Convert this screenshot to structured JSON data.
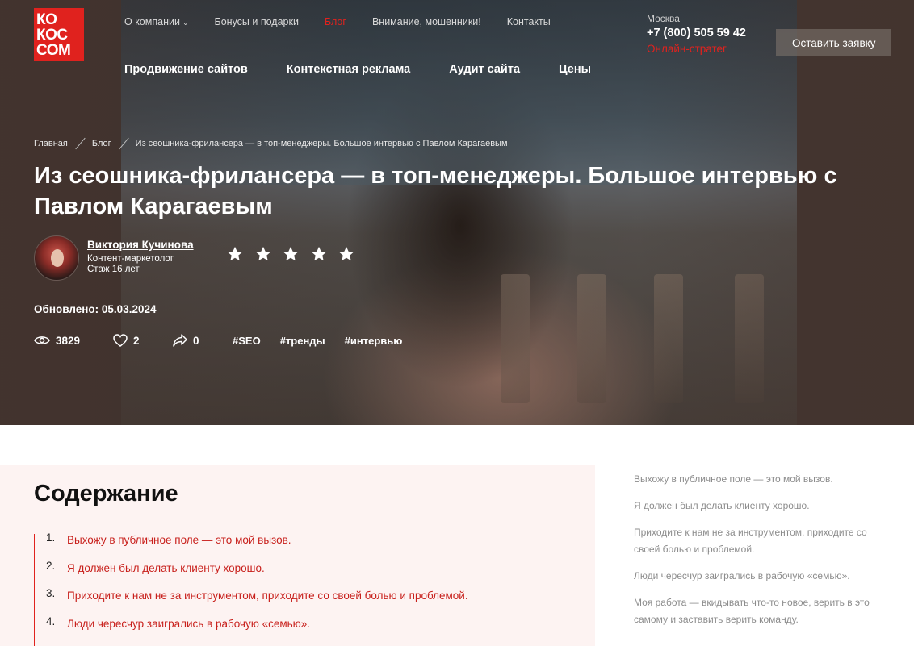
{
  "logo": {
    "lines": [
      "КО",
      "КОС",
      "СОМ"
    ]
  },
  "topnav": [
    {
      "label": "О компании",
      "dropdown": true,
      "active": false
    },
    {
      "label": "Бонусы и подарки",
      "active": false
    },
    {
      "label": "Блог",
      "active": true
    },
    {
      "label": "Внимание, мошенники!",
      "active": false
    },
    {
      "label": "Контакты",
      "active": false
    }
  ],
  "mainnav": [
    "Продвижение сайтов",
    "Контекстная реклама",
    "Аудит сайта",
    "Цены"
  ],
  "contact": {
    "city": "Москва",
    "phone": "+7 (800) 505 59 42",
    "strategist": "Онлайн-стратег"
  },
  "cta_label": "Оставить заявку",
  "breadcrumb": [
    "Главная",
    "Блог",
    "Из сеошника-фрилансера — в топ-менеджеры. Большое интервью с Павлом Карагаевым"
  ],
  "article": {
    "title": "Из сеошника-фрилансера — в топ-менеджеры. Большое интервью с Павлом Карагаевым",
    "author": {
      "name": "Виктория Кучинова",
      "role": "Контент-маркетолог",
      "experience": "Стаж 16 лет"
    },
    "rating": 5,
    "updated": "Обновлено: 05.03.2024",
    "views": "3829",
    "likes": "2",
    "shares": "0",
    "tags": [
      "#SEO",
      "#тренды",
      "#интервью"
    ]
  },
  "toc": {
    "title": "Содержание",
    "items": [
      {
        "num": "1.",
        "text": "Выхожу в публичное поле — это мой вызов."
      },
      {
        "num": "2.",
        "text": "Я должен был делать клиенту хорошо."
      },
      {
        "num": "3.",
        "text": "Приходите к нам не за инструментом, приходите со своей болью и проблемой."
      },
      {
        "num": "4.",
        "text": "Люди чересчур заигрались в рабочую «семью»."
      }
    ]
  },
  "sidebar": [
    "Выхожу в публичное поле — это мой вызов.",
    "Я должен был делать клиенту хорошо.",
    "Приходите к нам не за инструментом, приходите со своей болью и проблемой.",
    "Люди чересчур заигрались в рабочую «семью».",
    "Моя работа — вкидывать что-то новое, верить в это самому и заставить верить команду."
  ],
  "colors": {
    "accent": "#e0221e",
    "toc_bg": "#fdf3f2"
  }
}
